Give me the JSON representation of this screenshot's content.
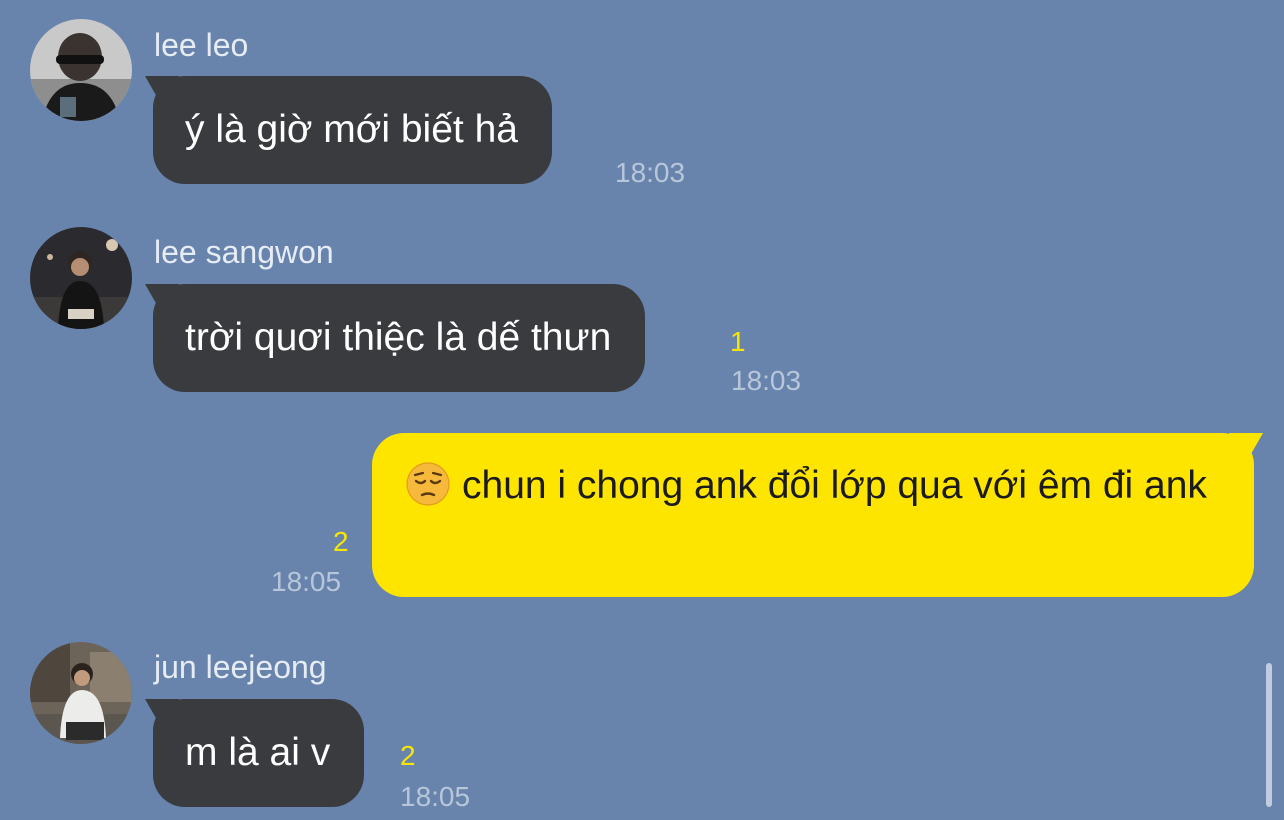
{
  "colors": {
    "background": "#6884ad",
    "incoming_bubble": "#3a3b3f",
    "outgoing_bubble": "#fee500",
    "unread_count": "#f7e600",
    "timestamp": "#b8c6da"
  },
  "messages": [
    {
      "sender": "lee leo",
      "avatar_icon": "profile-photo-icon",
      "text": "ý là giờ mới biết hả",
      "unread": "",
      "time": "18:03"
    },
    {
      "sender": "lee sangwon",
      "avatar_icon": "profile-photo-icon",
      "text": "trời quơi thiệc là dế thưn",
      "unread": "1",
      "time": "18:03"
    },
    {
      "sender": "",
      "outgoing": true,
      "emoji_icon": "pensive-face-emoji",
      "text": "chun i chong ank đổi lớp qua với êm đi ank",
      "unread": "2",
      "time": "18:05"
    },
    {
      "sender": "jun leejeong",
      "avatar_icon": "profile-photo-icon",
      "text": "m là ai v",
      "unread": "2",
      "time": "18:05"
    }
  ]
}
